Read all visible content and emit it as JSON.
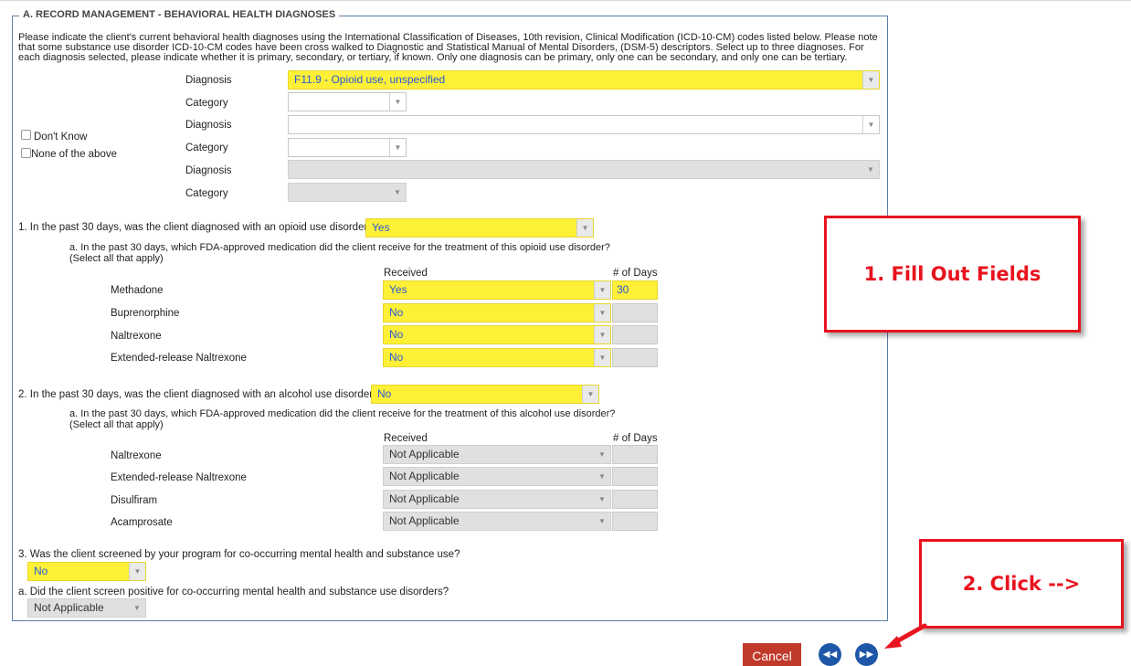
{
  "section_title": "A. RECORD MANAGEMENT - BEHAVIORAL HEALTH DIAGNOSES",
  "intro_text": "Please indicate the client's current behavioral health diagnoses using the International Classification of Diseases, 10th revision, Clinical Modification (ICD-10-CM) codes listed below. Please note that some substance use disorder ICD-10-CM codes have been cross walked to Diagnostic and Statistical Manual of Mental Disorders, (DSM-5) descriptors. Select up to three diagnoses. For each diagnosis selected, please indicate whether it is primary, secondary, or tertiary, if known. Only one diagnosis can be primary, only one can be secondary, and only one can be tertiary.",
  "diagnoses": {
    "diagnosis_label": "Diagnosis",
    "category_label": "Category",
    "diagnosis1_value": "F11.9 - Opioid use, unspecified",
    "category1_value": "",
    "diagnosis2_value": "",
    "category2_value": "",
    "diagnosis3_value": "",
    "category3_value": "",
    "dont_know_label": "Don't Know",
    "none_label": "None of the above"
  },
  "q1": {
    "question": "1. In the past 30 days, was the client diagnosed with an opioid use disorder?",
    "answer": "Yes",
    "sub_question_line1": "a. In the past 30 days, which FDA-approved medication did the client receive for the treatment of this opioid use disorder?",
    "sub_question_line2": "(Select all that apply)",
    "received_header": "Received",
    "days_header": "# of Days",
    "meds": [
      {
        "name": "Methadone",
        "received": "Yes",
        "days": "30"
      },
      {
        "name": "Buprenorphine",
        "received": "No",
        "days": ""
      },
      {
        "name": "Naltrexone",
        "received": "No",
        "days": ""
      },
      {
        "name": "Extended-release Naltrexone",
        "received": "No",
        "days": ""
      }
    ]
  },
  "q2": {
    "question": "2. In the past 30 days, was the client diagnosed with an alcohol use disorder?",
    "answer": "No",
    "sub_question_line1": "a. In the past 30 days, which FDA-approved medication did the client receive for the treatment of this alcohol use disorder?",
    "sub_question_line2": "(Select all that apply)",
    "received_header": "Received",
    "days_header": "# of Days",
    "meds": [
      {
        "name": "Naltrexone",
        "received": "Not Applicable",
        "days": ""
      },
      {
        "name": "Extended-release Naltrexone",
        "received": "Not Applicable",
        "days": ""
      },
      {
        "name": "Disulfiram",
        "received": "Not Applicable",
        "days": ""
      },
      {
        "name": "Acamprosate",
        "received": "Not Applicable",
        "days": ""
      }
    ]
  },
  "q3": {
    "question": "3. Was the client screened by your program for co-occurring mental health and substance use?",
    "answer": "No",
    "sub_question": "a. Did the client screen positive for co-occurring mental health and substance use disorders?",
    "sub_answer": "Not Applicable"
  },
  "buttons": {
    "cancel": "Cancel",
    "prev_icon": "rewind-icon",
    "next_icon": "fast-forward-icon"
  },
  "callouts": {
    "fill": "1. Fill Out Fields",
    "click": "2. Click -->"
  },
  "colors": {
    "highlight": "#fdf036",
    "disabled": "#e0e0e0",
    "cancel": "#c0392b",
    "nav": "#1f57a8",
    "callout": "#e8131e"
  }
}
